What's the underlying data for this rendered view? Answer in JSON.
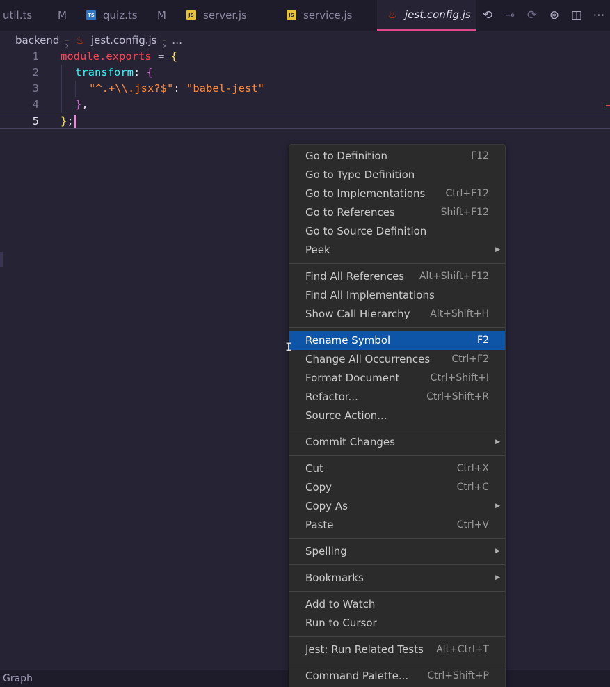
{
  "tabs": [
    {
      "label": "util.ts",
      "badge": "M",
      "icon": "ts-file-icon",
      "type": "ts"
    },
    {
      "label": "quiz.ts",
      "badge": "M",
      "icon": "ts-file-icon",
      "type": "ts"
    },
    {
      "label": "server.js",
      "badge": "",
      "icon": "js-file-icon",
      "type": "js"
    },
    {
      "label": "service.js",
      "badge": "",
      "icon": "js-file-icon",
      "type": "js"
    },
    {
      "label": "jest.config.js",
      "badge": "",
      "icon": "jest-file-icon",
      "type": "jest",
      "active": true
    }
  ],
  "breadcrumb": {
    "folder": "backend",
    "file": "jest.config.js",
    "more": "…"
  },
  "editor": {
    "line_numbers": [
      "1",
      "2",
      "3",
      "4",
      "5"
    ],
    "code": {
      "l1_module": "module",
      "l1_exports": ".exports",
      "l1_eq": " = ",
      "l1_brace": "{",
      "l2_transform": "transform",
      "l2_colon": ": ",
      "l2_brace": "{",
      "l3_key": "\"^.+\\\\.jsx?$\"",
      "l3_colon": ": ",
      "l3_value": "\"babel-jest\"",
      "l4_close": "}",
      "l4_comma": ",",
      "l5_close": "}",
      "l5_semi": ";"
    }
  },
  "bottom": {
    "graph_label": "Graph"
  },
  "menu": {
    "groups": [
      [
        {
          "label": "Go to Definition",
          "shortcut": "F12"
        },
        {
          "label": "Go to Type Definition",
          "shortcut": ""
        },
        {
          "label": "Go to Implementations",
          "shortcut": "Ctrl+F12"
        },
        {
          "label": "Go to References",
          "shortcut": "Shift+F12"
        },
        {
          "label": "Go to Source Definition",
          "shortcut": ""
        },
        {
          "label": "Peek",
          "shortcut": "",
          "submenu": true
        }
      ],
      [
        {
          "label": "Find All References",
          "shortcut": "Alt+Shift+F12"
        },
        {
          "label": "Find All Implementations",
          "shortcut": ""
        },
        {
          "label": "Show Call Hierarchy",
          "shortcut": "Alt+Shift+H"
        }
      ],
      [
        {
          "label": "Rename Symbol",
          "shortcut": "F2",
          "selected": true
        },
        {
          "label": "Change All Occurrences",
          "shortcut": "Ctrl+F2"
        },
        {
          "label": "Format Document",
          "shortcut": "Ctrl+Shift+I"
        },
        {
          "label": "Refactor...",
          "shortcut": "Ctrl+Shift+R"
        },
        {
          "label": "Source Action...",
          "shortcut": ""
        }
      ],
      [
        {
          "label": "Commit Changes",
          "shortcut": "",
          "submenu": true
        }
      ],
      [
        {
          "label": "Cut",
          "shortcut": "Ctrl+X"
        },
        {
          "label": "Copy",
          "shortcut": "Ctrl+C"
        },
        {
          "label": "Copy As",
          "shortcut": "",
          "submenu": true
        },
        {
          "label": "Paste",
          "shortcut": "Ctrl+V"
        }
      ],
      [
        {
          "label": "Spelling",
          "shortcut": "",
          "submenu": true
        }
      ],
      [
        {
          "label": "Bookmarks",
          "shortcut": "",
          "submenu": true
        }
      ],
      [
        {
          "label": "Add to Watch",
          "shortcut": ""
        },
        {
          "label": "Run to Cursor",
          "shortcut": ""
        }
      ],
      [
        {
          "label": "Jest: Run Related Tests",
          "shortcut": "Alt+Ctrl+T"
        }
      ],
      [
        {
          "label": "Command Palette...",
          "shortcut": "Ctrl+Shift+P"
        }
      ]
    ]
  },
  "actions": [
    "go-back-icon",
    "go-forward-dot-icon",
    "go-forward-icon",
    "source-control-icon",
    "split-editor-icon",
    "more-actions-icon"
  ]
}
